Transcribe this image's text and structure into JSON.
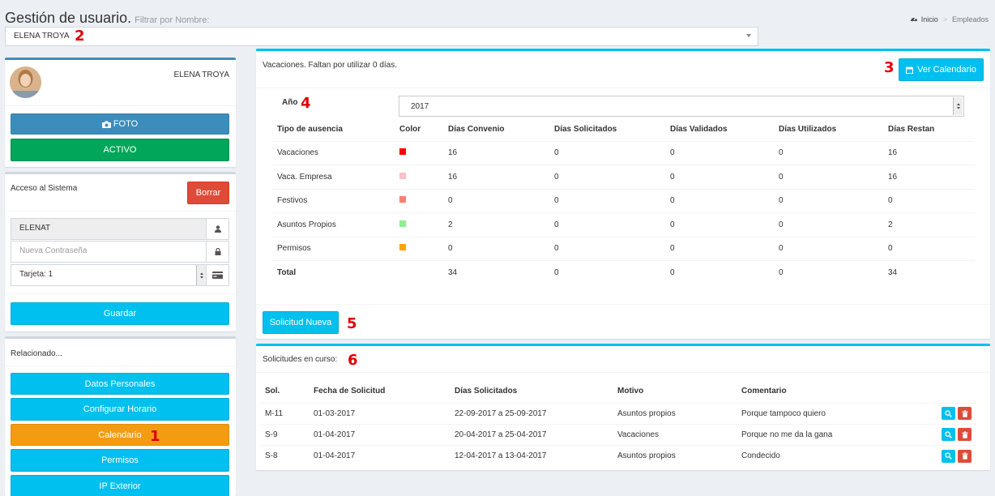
{
  "header": {
    "title": "Gestión de usuario.",
    "subtitle": "Filtrar por Nombre:",
    "breadcrumb": {
      "home": "Inicio",
      "current": "Empleados"
    }
  },
  "user_selector": {
    "value": "ELENA TROYA",
    "annotation": "2"
  },
  "profile": {
    "name": "ELENA TROYA",
    "foto_label": "FOTO",
    "activo_label": "ACTIVO"
  },
  "access": {
    "title": "Acceso al Sistema",
    "borrar_label": "Borrar",
    "username": "ELENAT",
    "password_placeholder": "Nueva Contraseña",
    "card_value": "Tarjeta: 1",
    "guardar_label": "Guardar"
  },
  "related": {
    "title": "Relacionado...",
    "items": [
      {
        "label": "Datos Personales"
      },
      {
        "label": "Configurar Horario"
      },
      {
        "label": "Calendario"
      },
      {
        "label": "Permisos"
      },
      {
        "label": "IP Exterior"
      }
    ],
    "annotation": "1"
  },
  "vacations": {
    "title": "Vacaciones. Faltan por utilizar 0 días.",
    "ver_calendario_label": "Ver Calendario",
    "annotation_btn": "3",
    "year_label": "Año",
    "annotation_year": "4",
    "year_value": "2017",
    "columns": [
      "Tipo de ausencia",
      "Color",
      "Días Convenio",
      "Días Solicitados",
      "Días Validados",
      "Días Utilizados",
      "Días Restan"
    ],
    "rows": [
      {
        "tipo": "Vacaciones",
        "color": "#ff0000",
        "convenio": "16",
        "solicitados": "0",
        "validados": "0",
        "utilizados": "0",
        "restan": "16"
      },
      {
        "tipo": "Vaca. Empresa",
        "color": "#ffc0cb",
        "convenio": "16",
        "solicitados": "0",
        "validados": "0",
        "utilizados": "0",
        "restan": "16"
      },
      {
        "tipo": "Festivos",
        "color": "#fa8072",
        "convenio": "0",
        "solicitados": "0",
        "validados": "0",
        "utilizados": "0",
        "restan": "0"
      },
      {
        "tipo": "Asuntos Propios",
        "color": "#90ee90",
        "convenio": "2",
        "solicitados": "0",
        "validados": "0",
        "utilizados": "0",
        "restan": "2"
      },
      {
        "tipo": "Permisos",
        "color": "#ffa500",
        "convenio": "0",
        "solicitados": "0",
        "validados": "0",
        "utilizados": "0",
        "restan": "0"
      }
    ],
    "total": {
      "label": "Total",
      "convenio": "34",
      "solicitados": "0",
      "validados": "0",
      "utilizados": "0",
      "restan": "34"
    },
    "solicitud_nueva_label": "Solicitud Nueva",
    "annotation_new": "5"
  },
  "requests": {
    "title": "Solicitudes en curso:",
    "annotation": "6",
    "columns": [
      "Sol.",
      "Fecha de Solicitud",
      "Días Solicitados",
      "Motivo",
      "Comentario"
    ],
    "rows": [
      {
        "sol": "M-11",
        "fecha": "01-03-2017",
        "dias": "22-09-2017 a 25-09-2017",
        "motivo": "Asuntos propios",
        "comentario": "Porque tampoco quiero"
      },
      {
        "sol": "S-9",
        "fecha": "01-04-2017",
        "dias": "20-04-2017 a 25-04-2017",
        "motivo": "Vacaciones",
        "comentario": "Porque no me da la gana"
      },
      {
        "sol": "S-8",
        "fecha": "01-04-2017",
        "dias": "12-04-2017 a 13-04-2017",
        "motivo": "Asuntos propios",
        "comentario": "Condecido"
      }
    ]
  }
}
